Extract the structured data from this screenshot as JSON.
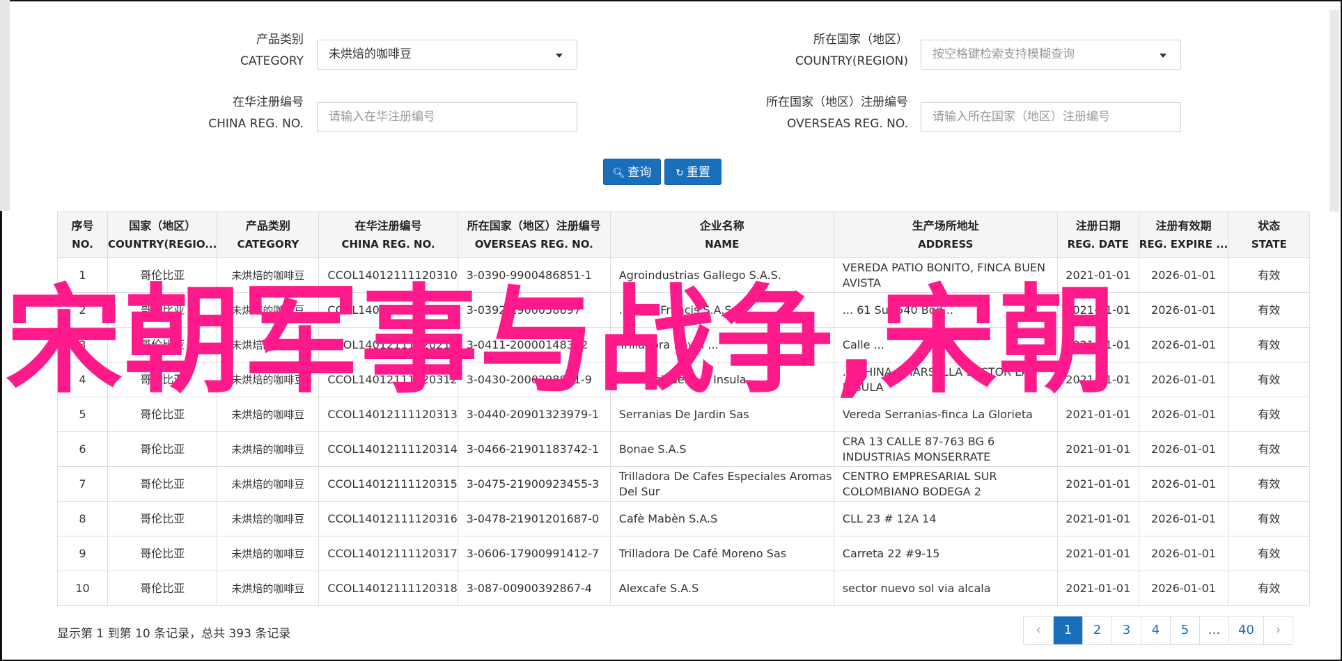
{
  "form": {
    "category": {
      "label_cn": "产品类别",
      "label_en": "CATEGORY",
      "value": "未烘焙的咖啡豆"
    },
    "country": {
      "label_cn": "所在国家（地区）",
      "label_en": "COUNTRY(REGION)",
      "placeholder": "按空格键检索支持模糊查询"
    },
    "china_reg": {
      "label_cn": "在华注册编号",
      "label_en": "CHINA REG. NO.",
      "placeholder": "请输入在华注册编号"
    },
    "overseas_reg": {
      "label_cn": "所在国家（地区）注册编号",
      "label_en": "OVERSEAS REG. NO.",
      "placeholder": "请输入所在国家（地区）注册编号"
    },
    "search_label": "查询",
    "reset_label": "重置"
  },
  "table": {
    "headers": [
      {
        "cn": "序号",
        "en": "NO."
      },
      {
        "cn": "国家（地区）",
        "en": "COUNTRY(REGIO..."
      },
      {
        "cn": "产品类别",
        "en": "CATEGORY"
      },
      {
        "cn": "在华注册编号",
        "en": "CHINA REG. NO."
      },
      {
        "cn": "所在国家（地区）注册编号",
        "en": "OVERSEAS REG. NO."
      },
      {
        "cn": "企业名称",
        "en": "NAME"
      },
      {
        "cn": "生产场所地址",
        "en": "ADDRESS"
      },
      {
        "cn": "注册日期",
        "en": "REG. DATE"
      },
      {
        "cn": "注册有效期",
        "en": "REG. EXPIRE ..."
      },
      {
        "cn": "状态",
        "en": "STATE"
      }
    ],
    "rows": [
      [
        "1",
        "哥伦比亚",
        "未烘焙的咖啡豆",
        "CCOL14012111120310",
        "3-0390-9900486851-1",
        "Agroindustrias Gallego S.A.S.",
        "VEREDA PATIO BONITO, FINCA BUEN AVISTA",
        "2021-01-01",
        "2026-01-01",
        "有效"
      ],
      [
        "2",
        "哥伦比亚",
        "未烘焙的咖啡豆",
        "CCOL14012111120311",
        "3-0392-1900058697",
        "... & St Francis S.A.S.",
        "... 61 Sur-540 Bod...",
        "2021-01-01",
        "2026-01-01",
        "有效"
      ],
      [
        "3",
        "哥伦比亚",
        "未烘焙的咖啡豆",
        "CCOL14012111120211",
        "3-0411-20000148312",
        "Trilladora Royal ...",
        "Calle ...",
        "2021-01-01",
        "2026-01-01",
        "有效"
      ],
      [
        "4",
        "哥伦比亚",
        "未烘焙的咖啡豆",
        "CCOL14012111120312",
        "3-0430-2000298861-9",
        "Beneficiadero ... Insula",
        "... CHINA - MARSELLA SECTOR LA INSULA",
        "2021-01-01",
        "2026-01-01",
        "有效"
      ],
      [
        "5",
        "哥伦比亚",
        "未烘焙的咖啡豆",
        "CCOL14012111120313",
        "3-0440-20901323979-1",
        "Serranias De Jardin Sas",
        "Vereda Serranias-finca La Glorieta",
        "2021-01-01",
        "2026-01-01",
        "有效"
      ],
      [
        "6",
        "哥伦比亚",
        "未烘焙的咖啡豆",
        "CCOL14012111120314",
        "3-0466-21901183742-1",
        "Bonae S.A.S",
        "CRA 13 CALLE 87-763 BG 6 INDUSTRIAS MONSERRATE",
        "2021-01-01",
        "2026-01-01",
        "有效"
      ],
      [
        "7",
        "哥伦比亚",
        "未烘焙的咖啡豆",
        "CCOL14012111120315",
        "3-0475-21900923455-3",
        "Trilladora De Cafes Especiales Aromas Del Sur",
        "CENTRO EMPRESARIAL SUR COLOMBIANO BODEGA 2",
        "2021-01-01",
        "2026-01-01",
        "有效"
      ],
      [
        "8",
        "哥伦比亚",
        "未烘焙的咖啡豆",
        "CCOL14012111120316",
        "3-0478-21901201687-0",
        "Cafè Mabèn S.A.S",
        "CLL 23 # 12A 14",
        "2021-01-01",
        "2026-01-01",
        "有效"
      ],
      [
        "9",
        "哥伦比亚",
        "未烘焙的咖啡豆",
        "CCOL14012111120317",
        "3-0606-17900991412-7",
        "Trilladora De Café Moreno Sas",
        "Carreta 22 #9-15",
        "2021-01-01",
        "2026-01-01",
        "有效"
      ],
      [
        "10",
        "哥伦比亚",
        "未烘焙的咖啡豆",
        "CCOL14012111120318",
        "3-087-00900392867-4",
        "Alexcafe S.A.S",
        "sector nuevo sol via alcala",
        "2021-01-01",
        "2026-01-01",
        "有效"
      ]
    ]
  },
  "footer": {
    "summary": "显示第 1 到第 10 条记录，总共 393 条记录"
  },
  "pagination": {
    "prev": "‹",
    "pages": [
      "1",
      "2",
      "3",
      "4",
      "5",
      "...",
      "40"
    ],
    "next": "›",
    "active": "1"
  },
  "overlay": {
    "watermark_text": "宋朝军事与战争,宋朝"
  },
  "colors": {
    "primary": "#1a6fbd",
    "watermark": "#ff1a8c"
  }
}
